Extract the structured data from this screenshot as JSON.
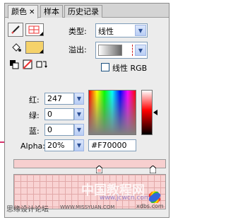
{
  "tabs": [
    {
      "label": "颜色",
      "close": "✕"
    },
    {
      "label": "样本"
    },
    {
      "label": "历史记录"
    }
  ],
  "type": {
    "label": "类型:",
    "value": "线性"
  },
  "overflow": {
    "label": "溢出:"
  },
  "linear_rgb": {
    "label": "线性 RGB",
    "checked": false
  },
  "channels": {
    "red": {
      "label": "红:",
      "value": "247"
    },
    "green": {
      "label": "绿:",
      "value": "0"
    },
    "blue": {
      "label": "蓝:",
      "value": "0"
    },
    "alpha": {
      "label": "Alpha:",
      "value": "20%"
    }
  },
  "hex": {
    "value": "#F70000"
  },
  "colors": {
    "fill_swatch": "#f5d26a",
    "current": "#f70000",
    "arrow": "#d6336c",
    "grid": "#f9d3d3"
  },
  "watermark": {
    "left": "思缘设计论坛",
    "url": "WWW.MISSYUAN.COM",
    "brand": "中国教程网",
    "site": "www.jcwcn.com",
    "site_small": "xdbs.com"
  }
}
